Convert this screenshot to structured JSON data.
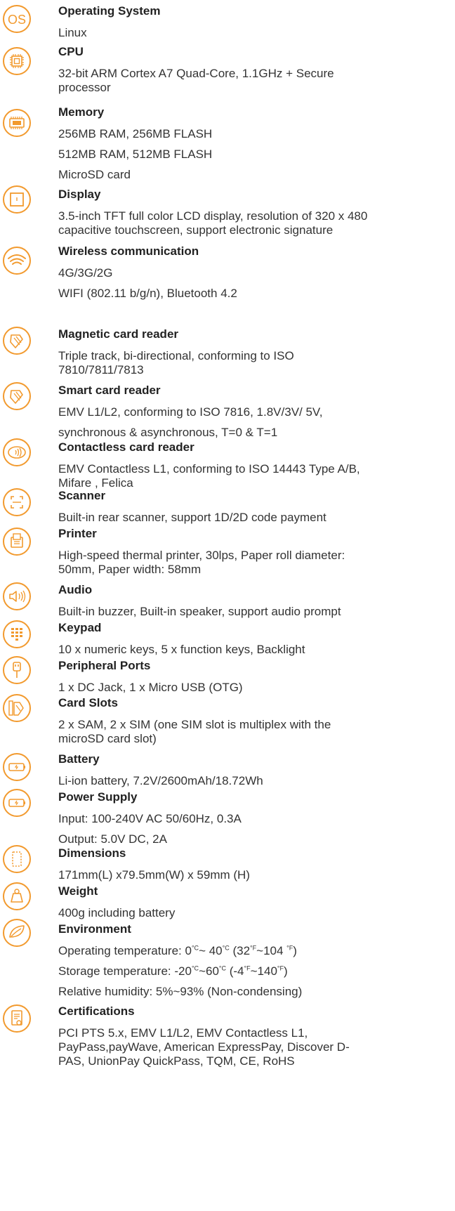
{
  "accent_color": "#f29a2e",
  "specs": [
    {
      "icon": "os-icon",
      "title": "Operating System",
      "lines": [
        "Linux"
      ]
    },
    {
      "icon": "cpu-icon",
      "title": "CPU",
      "lines": [
        "32-bit ARM Cortex A7 Quad-Core, 1.1GHz +  Secure processor"
      ]
    },
    {
      "icon": "memory-chip-icon",
      "title": "Memory",
      "lines": [
        "256MB RAM, 256MB FLASH",
        "512MB RAM, 512MB FLASH",
        "MicroSD card"
      ]
    },
    {
      "icon": "display-icon",
      "title": "Display",
      "lines": [
        "3.5-inch TFT full color LCD display, resolution of 320 x 480 capacitive touchscreen, support electronic signature"
      ]
    },
    {
      "icon": "wifi-icon",
      "title": "Wireless communication",
      "lines": [
        "4G/3G/2G",
        "WIFI (802.11 b/g/n), Bluetooth 4.2"
      ]
    },
    {
      "icon": "card-swipe-icon",
      "title": "Magnetic card reader",
      "lines": [
        "Triple track, bi-directional, conforming to ISO 7810/7811/7813"
      ]
    },
    {
      "icon": "card-insert-icon",
      "title": "Smart card reader",
      "lines": [
        "EMV L1/L2, conforming to ISO 7816, 1.8V/3V/ 5V,",
        "synchronous & asynchronous, T=0 & T=1"
      ]
    },
    {
      "icon": "contactless-icon",
      "title": "Contactless card reader",
      "lines": [
        "EMV Contactless L1, conforming to ISO 14443 Type A/B, Mifare , Felica"
      ]
    },
    {
      "icon": "scanner-icon",
      "title": "Scanner",
      "lines": [
        "Built-in rear scanner, support 1D/2D code payment"
      ]
    },
    {
      "icon": "printer-icon",
      "title": "Printer",
      "lines": [
        "High-speed thermal printer, 30lps, Paper roll diameter: 50mm, Paper  width: 58mm"
      ]
    },
    {
      "icon": "speaker-icon",
      "title": "Audio",
      "lines": [
        "Built-in buzzer, Built-in speaker, support audio prompt"
      ]
    },
    {
      "icon": "keypad-icon",
      "title": "Keypad",
      "lines": [
        "10 x numeric keys, 5 x function keys, Backlight"
      ]
    },
    {
      "icon": "usb-cable-icon",
      "title": "Peripheral Ports",
      "lines": [
        "1 x DC Jack, 1 x Micro USB (OTG)"
      ]
    },
    {
      "icon": "card-slot-icon",
      "title": "Card Slots",
      "lines": [
        "2 x SAM, 2 x SIM (one SIM slot is multiplex with the microSD card slot)"
      ]
    },
    {
      "icon": "battery-icon",
      "title": "Battery",
      "lines": [
        "Li-ion battery, 7.2V/2600mAh/18.72Wh"
      ]
    },
    {
      "icon": "power-supply-icon",
      "title": "Power Supply",
      "lines": [
        "Input: 100-240V AC 50/60Hz, 0.3A",
        "Output: 5.0V DC, 2A"
      ]
    },
    {
      "icon": "dimensions-icon",
      "title": "Dimensions",
      "lines": [
        "171mm(L) x79.5mm(W) x 59mm (H)"
      ]
    },
    {
      "icon": "weight-icon",
      "title": "Weight",
      "lines": [
        "400g including battery"
      ]
    },
    {
      "icon": "leaf-icon",
      "title": "Environment",
      "lines": [
        "Operating temperature: 0℃~ 40℃ (32℉~104 ℉)",
        "Storage temperature: -20℃~60℃ (-4℉~140℉)",
        "Relative humidity: 5%~93% (Non-condensing)"
      ]
    },
    {
      "icon": "certificate-icon",
      "title": "Certifications",
      "lines": [
        "PCI PTS 5.x, EMV  L1/L2, EMV Contactless L1, PayPass,payWave, American ExpressPay, Discover D-PAS, UnionPay QuickPass, TQM, CE, RoHS"
      ]
    }
  ]
}
